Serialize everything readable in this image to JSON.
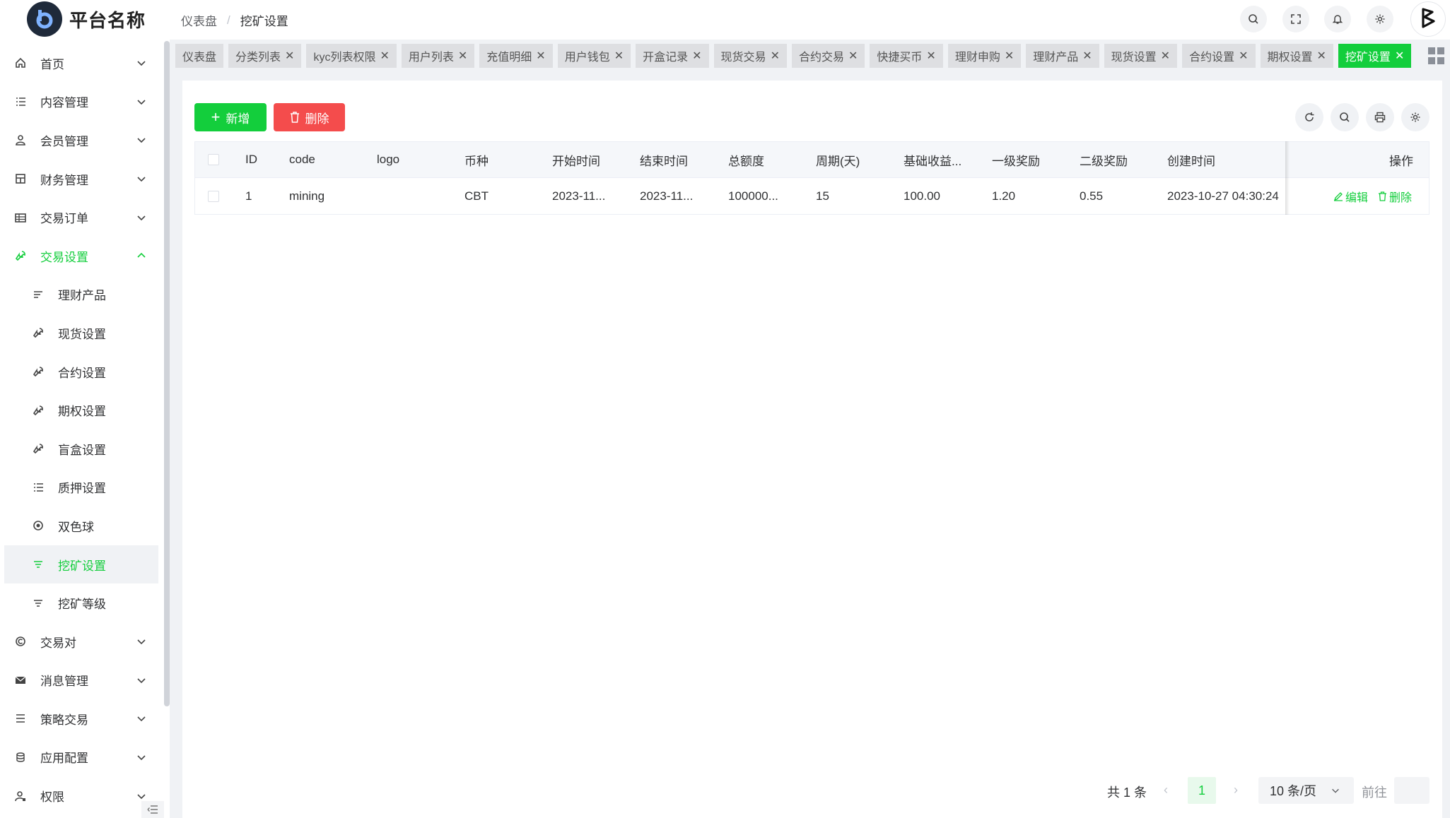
{
  "app": {
    "name": "平台名称"
  },
  "breadcrumb": [
    "仪表盘",
    "挖矿设置"
  ],
  "sidebar": {
    "items": [
      {
        "label": "首页",
        "icon": "home-icon"
      },
      {
        "label": "内容管理",
        "icon": "list-icon"
      },
      {
        "label": "会员管理",
        "icon": "user-icon"
      },
      {
        "label": "财务管理",
        "icon": "grid-icon"
      },
      {
        "label": "交易订单",
        "icon": "table-icon"
      },
      {
        "label": "交易设置",
        "icon": "wrench-icon"
      },
      {
        "label": "交易对",
        "icon": "copyright-icon"
      },
      {
        "label": "消息管理",
        "icon": "message-icon"
      },
      {
        "label": "策略交易",
        "icon": "menu-icon"
      },
      {
        "label": "应用配置",
        "icon": "coins-icon"
      },
      {
        "label": "权限",
        "icon": "user-lock-icon"
      }
    ],
    "submenu": [
      {
        "label": "理财产品",
        "icon": "sort-icon"
      },
      {
        "label": "现货设置",
        "icon": "wrench-icon"
      },
      {
        "label": "合约设置",
        "icon": "wrench-icon"
      },
      {
        "label": "期权设置",
        "icon": "wrench-icon"
      },
      {
        "label": "盲盒设置",
        "icon": "wrench-icon"
      },
      {
        "label": "质押设置",
        "icon": "list-icon"
      },
      {
        "label": "双色球",
        "icon": "target-icon"
      },
      {
        "label": "挖矿设置",
        "icon": "filter-icon"
      },
      {
        "label": "挖矿等级",
        "icon": "filter-icon"
      }
    ]
  },
  "tabs": [
    "仪表盘",
    "分类列表",
    "kyc列表权限",
    "用户列表",
    "充值明细",
    "用户钱包",
    "开盒记录",
    "现货交易",
    "合约交易",
    "快捷买币",
    "理财申购",
    "理财产品",
    "现货设置",
    "合约设置",
    "期权设置",
    "挖矿设置"
  ],
  "toolbar": {
    "add_label": "新增",
    "delete_label": "删除"
  },
  "table": {
    "headers": [
      "ID",
      "code",
      "logo",
      "币种",
      "开始时间",
      "结束时间",
      "总额度",
      "周期(天)",
      "基础收益...",
      "一级奖励",
      "二级奖励",
      "创建时间",
      "操作"
    ],
    "rows": [
      [
        "1",
        "mining",
        "",
        "CBT",
        "2023-11...",
        "2023-11...",
        "100000...",
        "15",
        "100.00",
        "1.20",
        "0.55",
        "2023-10-27 04:30:24"
      ]
    ],
    "actions": {
      "edit": "编辑",
      "delete": "删除"
    }
  },
  "pagination": {
    "total": "共 1 条",
    "current_page": "1",
    "page_size": "10 条/页",
    "goto": "前往"
  },
  "colors": {
    "accent": "#13ce3c",
    "danger": "#f44c4c"
  }
}
